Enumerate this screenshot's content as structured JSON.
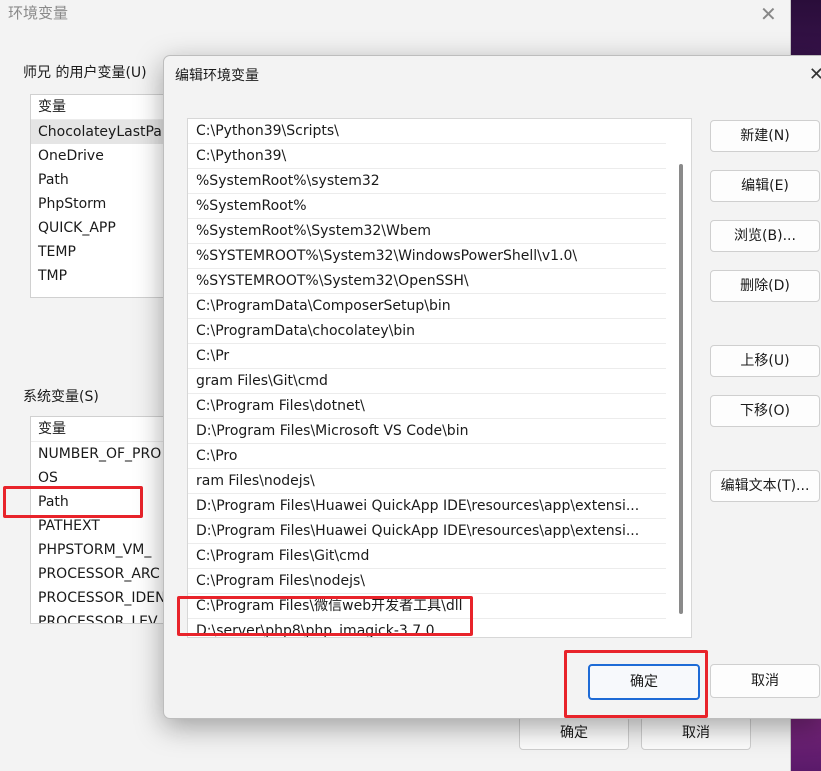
{
  "back_window": {
    "title": "环境变量",
    "user_group_label": "师兄 的用户变量(U)",
    "user_list": {
      "header": "变量",
      "items": [
        "ChocolateyLastPa",
        "OneDrive",
        "Path",
        "PhpStorm",
        "QUICK_APP",
        "TEMP",
        "TMP"
      ]
    },
    "system_group_label": "系统变量(S)",
    "system_list": {
      "header": "变量",
      "items": [
        "NUMBER_OF_PRO",
        "OS",
        "Path",
        "PATHEXT",
        "PHPSTORM_VM_",
        "PROCESSOR_ARC",
        "PROCESSOR_IDEN",
        "PROCESSOR_LEV"
      ]
    },
    "ok_label": "确定",
    "cancel_label": "取消"
  },
  "dialog": {
    "title": "编辑环境变量",
    "paths": [
      "C:\\Python39\\Scripts\\",
      "C:\\Python39\\",
      "%SystemRoot%\\system32",
      "%SystemRoot%",
      "%SystemRoot%\\System32\\Wbem",
      "%SYSTEMROOT%\\System32\\WindowsPowerShell\\v1.0\\",
      "%SYSTEMROOT%\\System32\\OpenSSH\\",
      "C:\\ProgramData\\ComposerSetup\\bin",
      "C:\\ProgramData\\chocolatey\\bin",
      "C:\\Pr",
      "gram Files\\Git\\cmd",
      "C:\\Program Files\\dotnet\\",
      "D:\\Program Files\\Microsoft VS Code\\bin",
      "C:\\Pro",
      "ram Files\\nodejs\\",
      "D:\\Program Files\\Huawei QuickApp IDE\\resources\\app\\extensi...",
      "D:\\Program Files\\Huawei QuickApp IDE\\resources\\app\\extensi...",
      "C:\\Program Files\\Git\\cmd",
      "C:\\Program Files\\nodejs\\",
      "C:\\Program Files\\微信web开发者工具\\dll",
      "D:\\server\\php8\\php_imagick-3.7.0"
    ],
    "buttons": {
      "new": "新建(N)",
      "edit": "编辑(E)",
      "browse": "浏览(B)...",
      "delete": "删除(D)",
      "move_up": "上移(U)",
      "move_down": "下移(O)",
      "edit_text": "编辑文本(T)..."
    },
    "ok_label": "确定",
    "cancel_label": "取消"
  },
  "colors": {
    "highlight": "#e8232a",
    "accent": "#1e6bd6"
  }
}
